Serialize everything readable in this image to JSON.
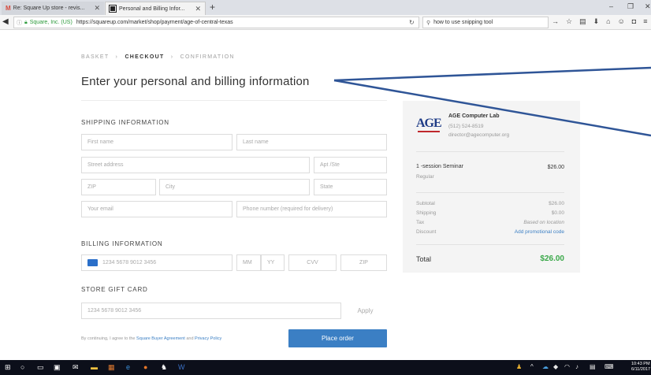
{
  "browser": {
    "tabs": [
      {
        "label": "Re: Square Up store - revis...",
        "icon": "gmail-icon"
      },
      {
        "label": "Personal and Billing Infor...",
        "icon": "square-icon"
      }
    ],
    "url_org": "Square, Inc. (US)",
    "url": "https://squareup.com/market/shop/payment/age-of-central-texas",
    "search_value": "how to use snipping tool"
  },
  "breadcrumb": {
    "basket": "BASKET",
    "checkout": "CHECKOUT",
    "confirmation": "CONFIRMATION",
    "separator": "›"
  },
  "page_title": "Enter your personal and billing information",
  "shipping": {
    "heading": "SHIPPING INFORMATION",
    "first_name": "First name",
    "last_name": "Last name",
    "street": "Street address",
    "apt": "Apt /Ste",
    "zip": "ZIP",
    "city": "City",
    "state": "State",
    "email": "Your email",
    "phone": "Phone number (required for delivery)"
  },
  "billing": {
    "heading": "BILLING INFORMATION",
    "card_number": "1234 5678 9012 3456",
    "mm": "MM",
    "yy": "YY",
    "cvv": "CVV",
    "zip": "ZIP"
  },
  "gift": {
    "heading": "STORE GIFT CARD",
    "card_number": "1234 5678 9012 3456",
    "apply_label": "Apply"
  },
  "terms": {
    "prefix": "By continuing, I agree to the",
    "link1": "Square Buyer Agreement",
    "middle": "and",
    "link2": "Privacy Policy"
  },
  "place_order_label": "Place order",
  "summary": {
    "logo_text": "AGE",
    "business_name": "AGE Computer Lab",
    "phone": "(512) 524-8519",
    "email": "director@agecomputer.org",
    "item_name": "1 -session Seminar",
    "item_variant": "Regular",
    "item_price": "$26.00",
    "subtotal_label": "Subtotal",
    "subtotal": "$26.00",
    "shipping_label": "Shipping",
    "shipping": "$0.00",
    "tax_label": "Tax",
    "tax": "Based on location",
    "discount_label": "Discount",
    "discount": "Add promotional code",
    "total_label": "Total",
    "total": "$26.00"
  },
  "taskbar": {
    "time": "10:43 PM",
    "date": "6/11/2017"
  },
  "colors": {
    "accent": "#3b7fc4",
    "total_green": "#3aa849",
    "annotation_blue": "#2f5597"
  }
}
